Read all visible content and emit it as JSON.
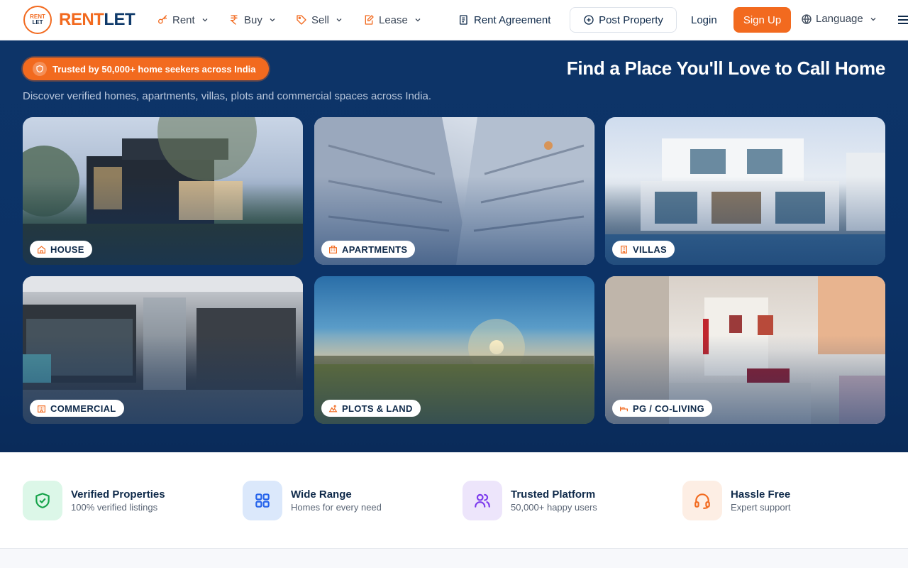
{
  "brand": {
    "badge_top": "RENT",
    "badge_bottom": "LET",
    "name_part1": "RENT",
    "name_part2": "LET"
  },
  "nav": {
    "items": [
      {
        "label": "Rent",
        "icon": "key-icon"
      },
      {
        "label": "Buy",
        "icon": "rupee-icon"
      },
      {
        "label": "Sell",
        "icon": "tag-icon"
      },
      {
        "label": "Lease",
        "icon": "edit-document-icon"
      }
    ],
    "rent_agreement": "Rent Agreement",
    "post_property": "Post Property",
    "login": "Login",
    "signup": "Sign Up",
    "language": "Language"
  },
  "hero": {
    "badge": "Trusted by 50,000+ home seekers across India",
    "title": "Find a Place You'll Love to Call Home",
    "subtitle": "Discover verified homes, apartments, villas, plots and commercial spaces across India."
  },
  "categories": [
    {
      "label": "HOUSE",
      "icon": "home-icon"
    },
    {
      "label": "APARTMENTS",
      "icon": "building-icon"
    },
    {
      "label": "VILLAS",
      "icon": "villa-icon"
    },
    {
      "label": "COMMERCIAL",
      "icon": "office-icon"
    },
    {
      "label": "PLOTS & LAND",
      "icon": "land-icon"
    },
    {
      "label": "PG / CO-LIVING",
      "icon": "bed-icon"
    }
  ],
  "features": [
    {
      "title": "Verified Properties",
      "subtitle": "100% verified listings",
      "icon": "shield-check-icon",
      "color": "#16a34a",
      "bg": "#dcf7e8"
    },
    {
      "title": "Wide Range",
      "subtitle": "Homes for every need",
      "icon": "grid-icon",
      "color": "#2563eb",
      "bg": "#dbe8fb"
    },
    {
      "title": "Trusted Platform",
      "subtitle": "50,000+ happy users",
      "icon": "users-icon",
      "color": "#7c3aed",
      "bg": "#ede5fb"
    },
    {
      "title": "Hassle Free",
      "subtitle": "Expert support",
      "icon": "headset-icon",
      "color": "#f26a1f",
      "bg": "#fdeee4"
    }
  ],
  "colors": {
    "accent": "#f26a1f",
    "navy": "#0c3266"
  }
}
